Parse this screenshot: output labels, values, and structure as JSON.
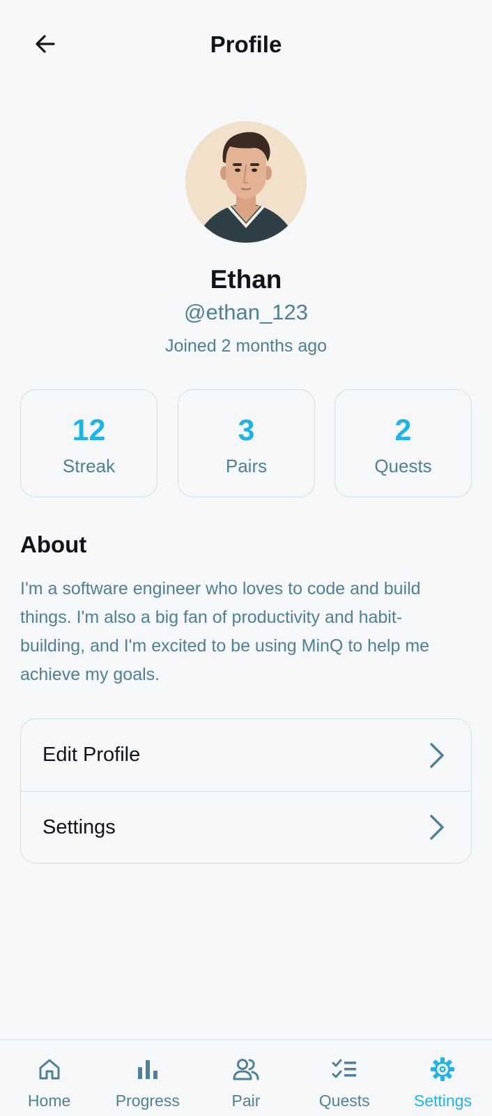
{
  "header": {
    "title": "Profile",
    "back_icon": "arrow-left-icon"
  },
  "profile": {
    "name": "Ethan",
    "handle": "@ethan_123",
    "joined": "Joined 2 months ago",
    "avatar_icon": "avatar-illustration"
  },
  "stats": [
    {
      "value": "12",
      "label": "Streak"
    },
    {
      "value": "3",
      "label": "Pairs"
    },
    {
      "value": "2",
      "label": "Quests"
    }
  ],
  "about": {
    "heading": "About",
    "text": "I'm a software engineer who loves to code and build things. I'm also a big fan of productivity and habit-building, and I'm excited to be using MinQ to help me achieve my goals."
  },
  "menu": [
    {
      "label": "Edit Profile",
      "icon": "chevron-right-icon"
    },
    {
      "label": "Settings",
      "icon": "chevron-right-icon"
    }
  ],
  "nav": [
    {
      "label": "Home",
      "icon": "home-icon"
    },
    {
      "label": "Progress",
      "icon": "bar-chart-icon"
    },
    {
      "label": "Pair",
      "icon": "users-icon"
    },
    {
      "label": "Quests",
      "icon": "checklist-icon"
    },
    {
      "label": "Settings",
      "icon": "gear-icon",
      "active": true
    }
  ],
  "colors": {
    "accent": "#1fb3e8",
    "muted": "#4f8096",
    "border": "#cfdfe6",
    "background": "#f5f7f8"
  }
}
